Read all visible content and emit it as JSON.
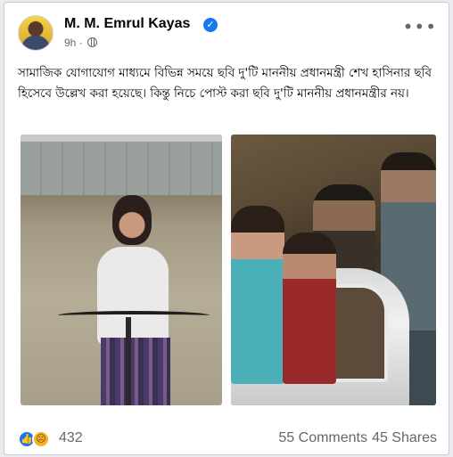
{
  "post": {
    "author": "M. M. Emrul Kayas",
    "verified": true,
    "time": "9h",
    "text": "সামাজিক যোগাযোগ মাধ্যমে বিভিন্ন সময়ে ছবি দু'টি মাননীয় প্রধানমন্ত্রী শেখ হাসিনার ছবি হিসেবে উল্লেখ করা হয়েছে। কিন্তু নিচে পোস্ট করা ছবি দু'টি মাননীয় প্রধানমন্ত্রীর নয়।"
  },
  "icons": {
    "verified": "check-badge-icon",
    "privacy": "globe-icon",
    "more": "ellipsis-icon",
    "like": "like-reaction-icon",
    "sad": "sad-reaction-icon"
  },
  "stats": {
    "reactions": "432",
    "comments": "55 Comments",
    "shares": "45 Shares"
  },
  "colors": {
    "accent": "#1877f2",
    "secondary_text": "#65676b"
  }
}
